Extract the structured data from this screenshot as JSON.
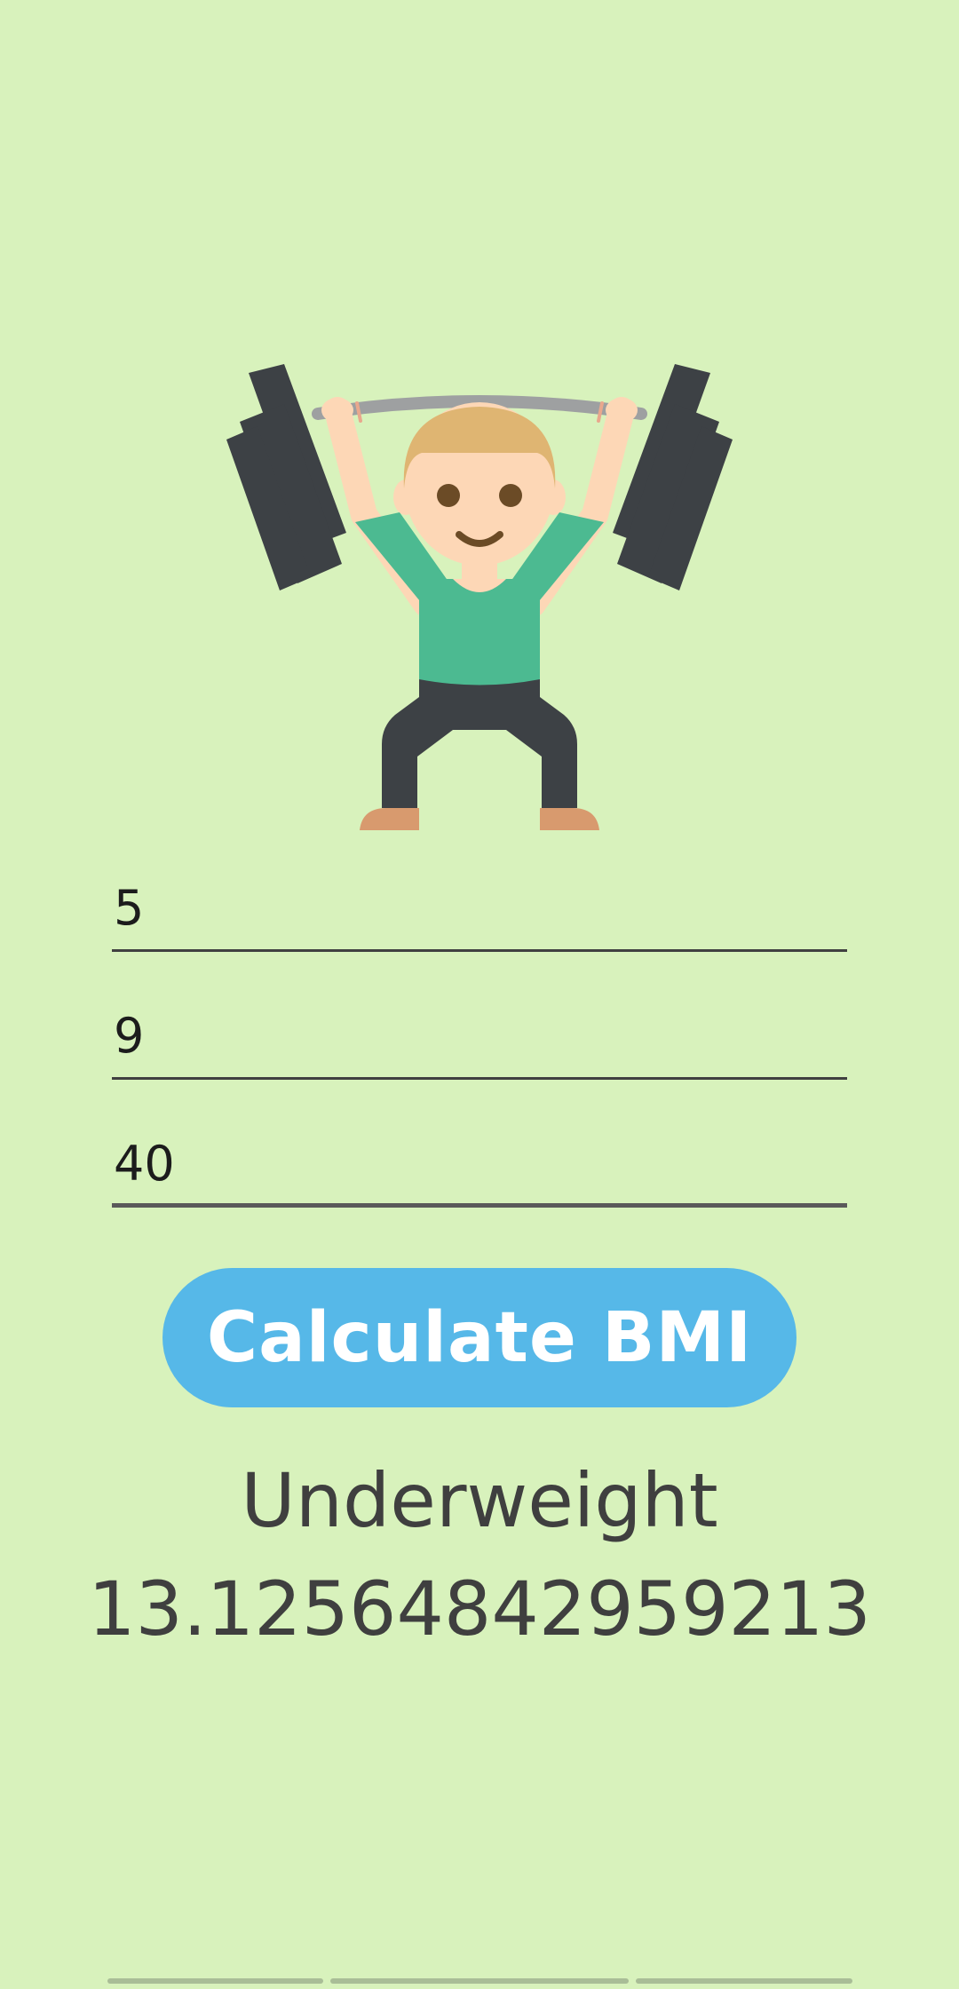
{
  "form": {
    "field_1_value": "5",
    "field_2_value": "9",
    "field_3_value": "40"
  },
  "button": {
    "label": "Calculate BMI"
  },
  "result": {
    "category": "Underweight",
    "value": "13.12564842959213"
  },
  "icons": {
    "illustration": "weightlifter-icon"
  },
  "colors": {
    "background": "#d8f2bc",
    "button": "#56b8e8",
    "text": "#3f3f3f"
  }
}
